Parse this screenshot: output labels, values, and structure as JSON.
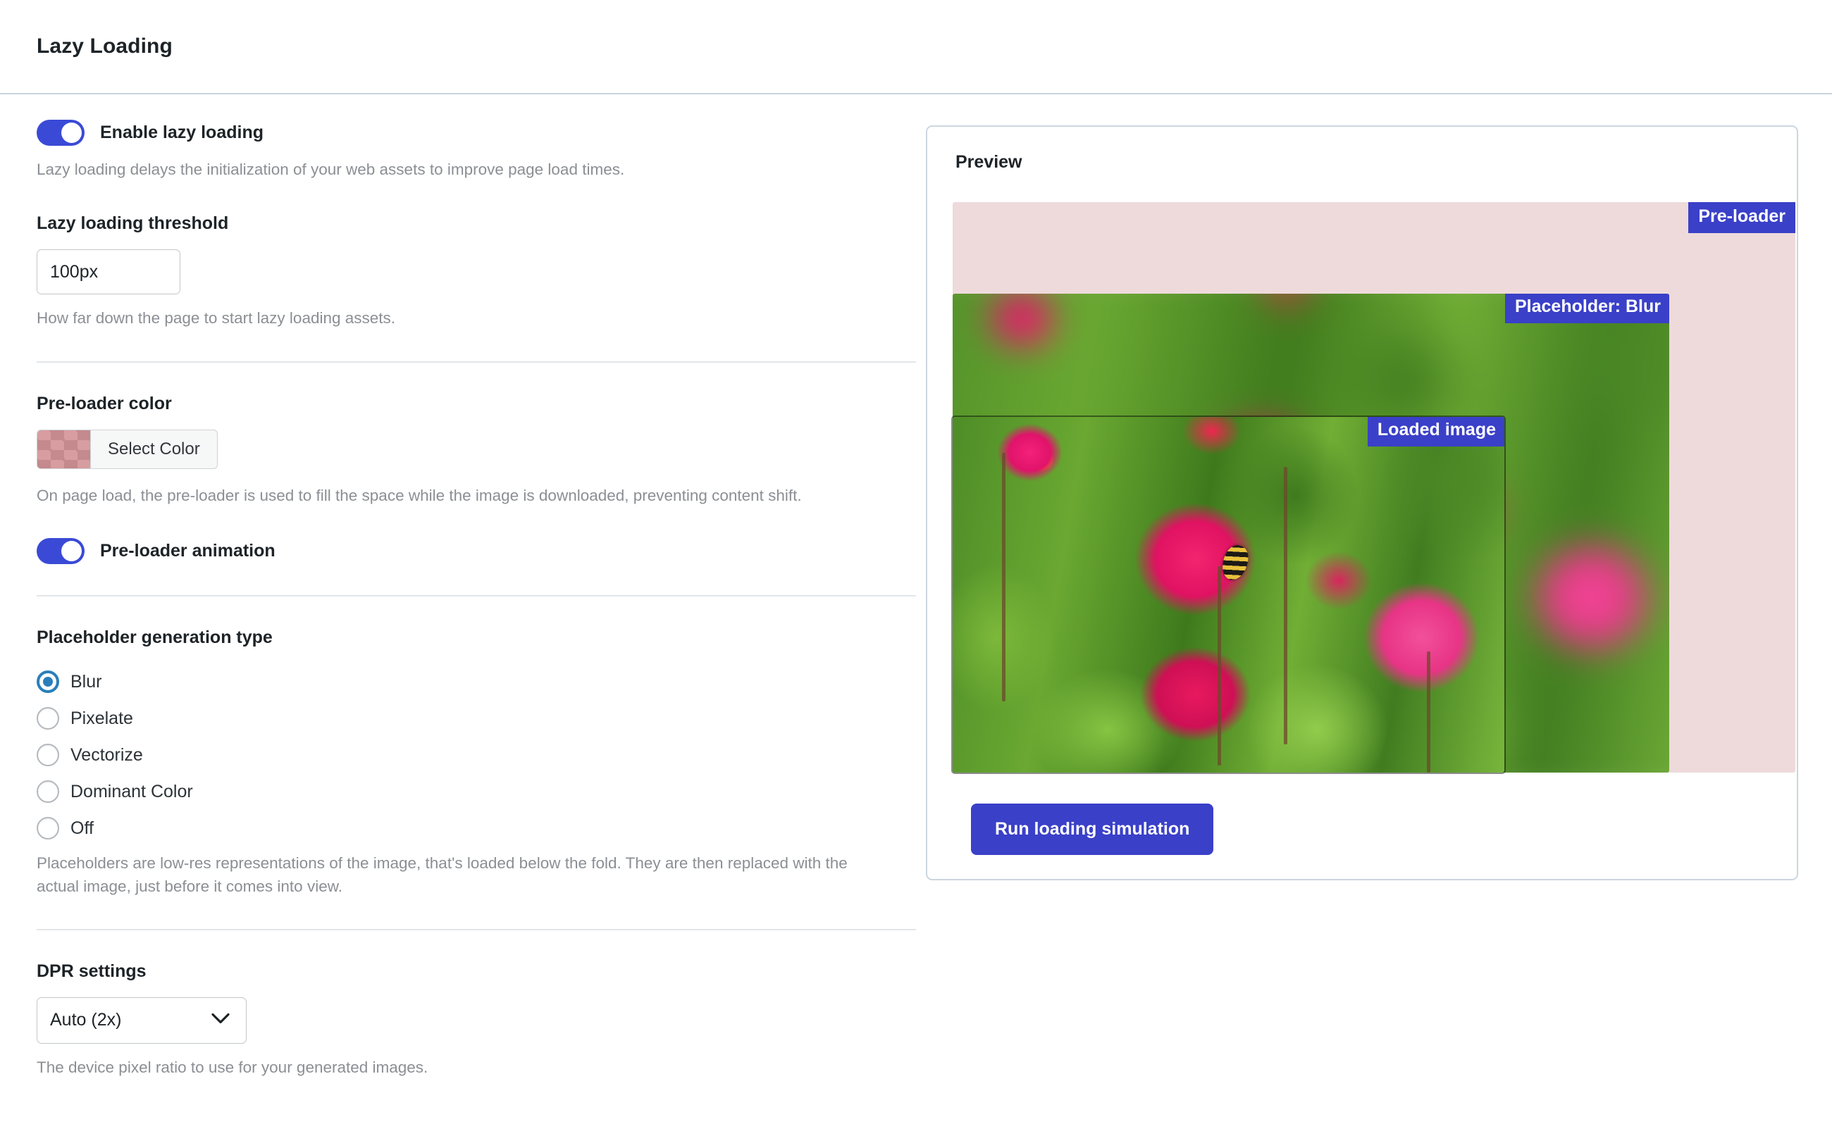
{
  "header": {
    "title": "Lazy Loading"
  },
  "settings": {
    "enable_lazy_loading": {
      "label": "Enable lazy loading",
      "state": "on",
      "help": "Lazy loading delays the initialization of your web assets to improve page load times."
    },
    "threshold": {
      "label": "Lazy loading threshold",
      "value": "100px",
      "placeholder": "100px",
      "help": "How far down the page to start lazy loading assets."
    },
    "preloader_color": {
      "label": "Pre-loader color",
      "button_label": "Select Color",
      "swatch_color": "#d79da0",
      "help": "On page load, the pre-loader is used to fill the space while the image is downloaded, preventing content shift."
    },
    "preloader_animation": {
      "label": "Pre-loader animation",
      "state": "on"
    },
    "placeholder_type": {
      "label": "Placeholder generation type",
      "selected": "Blur",
      "options": [
        "Blur",
        "Pixelate",
        "Vectorize",
        "Dominant Color",
        "Off"
      ],
      "help": "Placeholders are low-res representations of the image, that's loaded below the fold. They are then replaced with the actual image, just before it comes into view."
    },
    "dpr": {
      "label": "DPR settings",
      "selected": "Auto (2x)",
      "help": "The device pixel ratio to use for your generated images."
    }
  },
  "preview": {
    "title": "Preview",
    "layers": {
      "preloader_tag": "Pre-loader",
      "placeholder_tag": "Placeholder: Blur",
      "loaded_tag": "Loaded image"
    },
    "run_button": "Run loading simulation"
  },
  "colors": {
    "accent_blue": "#3a40c8",
    "toggle_on": "#3a4ad6",
    "radio_checked": "#2a7fba",
    "preloader_fill": "#eedadb"
  }
}
